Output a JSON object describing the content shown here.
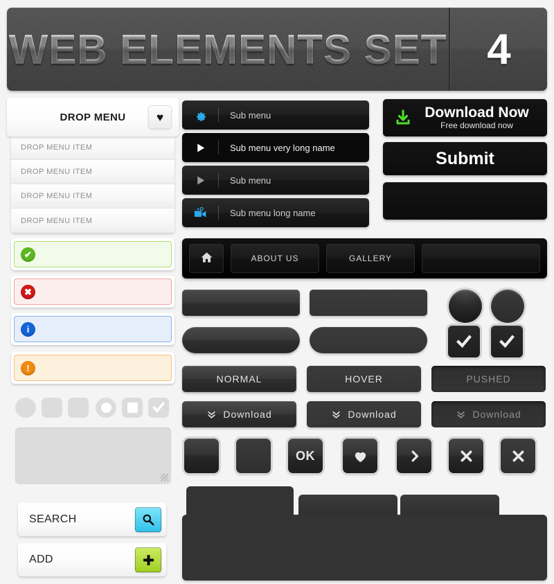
{
  "banner": {
    "title": "WEB ELEMENTS SET",
    "number": "4"
  },
  "drop_menu": {
    "label": "DROP MENU",
    "toggle_icon": "heart-icon",
    "toggle_glyph": "♥",
    "items": [
      {
        "label": "DROP MENU ITEM"
      },
      {
        "label": "DROP MENU ITEM"
      },
      {
        "label": "DROP MENU ITEM"
      },
      {
        "label": "DROP MENU ITEM"
      }
    ]
  },
  "sub_menus": [
    {
      "label": "Sub menu",
      "icon": "gear-icon",
      "glyph": "⚙",
      "icon_color": "#2aa8e8",
      "style": "dark-grey"
    },
    {
      "label": "Sub menu very long name",
      "icon": "play-icon",
      "glyph": "▶",
      "icon_color": "#ffffff",
      "style": "black"
    },
    {
      "label": "Sub menu",
      "icon": "play-icon",
      "glyph": "▶",
      "icon_color": "#9a9a9a",
      "style": "dark-grey"
    },
    {
      "label": "Sub menu long name",
      "icon": "video-camera-icon",
      "glyph": "🎥",
      "icon_color": "#2aa8e8",
      "style": "dark-grey"
    }
  ],
  "download_button": {
    "title": "Download Now",
    "subtitle": "Free download now",
    "icon": "download-arrow-icon",
    "icon_color": "#4ade2a"
  },
  "submit_button": {
    "label": "Submit"
  },
  "empty_black_button": {
    "label": ""
  },
  "alerts": [
    {
      "type": "success",
      "icon": "check-circle-icon",
      "glyph": "✔",
      "dot_color": "#5cb820",
      "border_color": "#a8dd6e",
      "bg_color": "#f2fbe9"
    },
    {
      "type": "error",
      "icon": "x-circle-icon",
      "glyph": "✖",
      "dot_color": "#d01818",
      "border_color": "#f0a0a0",
      "bg_color": "#fdeeee"
    },
    {
      "type": "info",
      "icon": "info-circle-icon",
      "glyph": "i",
      "dot_color": "#1565d8",
      "border_color": "#86b4ec",
      "bg_color": "#e7eefb"
    },
    {
      "type": "warning",
      "icon": "warning-circle-icon",
      "glyph": "!",
      "dot_color": "#f08a10",
      "border_color": "#f5c179",
      "bg_color": "#fdf0dc"
    }
  ],
  "navbar": {
    "home_icon": "home-icon",
    "home_glyph": "⌂",
    "tabs": [
      {
        "label": "ABOUT US"
      },
      {
        "label": "GALLERY"
      },
      {
        "label": ""
      }
    ]
  },
  "button_states": [
    {
      "label": "NORMAL",
      "state": "normal"
    },
    {
      "label": "HOVER",
      "state": "hover"
    },
    {
      "label": "PUSHED",
      "state": "pushed"
    }
  ],
  "download_row": [
    {
      "label": "Download",
      "state": "normal",
      "icon": "double-chevron-down-icon",
      "glyph": "⌄"
    },
    {
      "label": "Download",
      "state": "hover",
      "icon": "double-chevron-down-icon",
      "glyph": "⌄"
    },
    {
      "label": "Download",
      "state": "pushed",
      "icon": "double-chevron-down-icon",
      "glyph": "⌄"
    }
  ],
  "icon_buttons": [
    {
      "label": "",
      "icon": "blank-icon",
      "glyph": "",
      "variant": "g1"
    },
    {
      "label": "",
      "icon": "blank-icon",
      "glyph": "",
      "variant": "g2"
    },
    {
      "label": "OK",
      "icon": "ok-text-icon",
      "glyph": "OK",
      "variant": "g1"
    },
    {
      "label": "",
      "icon": "heart-icon",
      "glyph": "♥",
      "variant": "g1"
    },
    {
      "label": "",
      "icon": "chevron-right-icon",
      "glyph": "❯",
      "variant": "g1"
    },
    {
      "label": "",
      "icon": "close-x-icon",
      "glyph": "✖",
      "variant": "g1"
    },
    {
      "label": "",
      "icon": "close-x-icon",
      "glyph": "✖",
      "variant": "g2"
    }
  ],
  "round_buttons": [
    {
      "style": "glossy"
    },
    {
      "style": "matte"
    }
  ],
  "check_buttons": [
    {
      "icon": "checkmark-icon",
      "glyph": "✔",
      "checked": true
    },
    {
      "icon": "checkmark-icon",
      "glyph": "✔",
      "checked": true
    }
  ],
  "form_controls": [
    {
      "name": "radio-circle",
      "shape": "circle",
      "inner": "none"
    },
    {
      "name": "rounded-square-1",
      "shape": "rsq",
      "inner": "none"
    },
    {
      "name": "rounded-square-2",
      "shape": "rsq",
      "inner": "none"
    },
    {
      "name": "radio-unchecked",
      "shape": "circle",
      "inner": "circle"
    },
    {
      "name": "checkbox-unchecked",
      "shape": "rsq",
      "inner": "square"
    },
    {
      "name": "checkbox-checked",
      "shape": "rsq",
      "inner": "check",
      "glyph": "✔"
    }
  ],
  "textarea": {
    "value": "",
    "placeholder": ""
  },
  "fields": [
    {
      "label": "SEARCH",
      "button_icon": "search-icon",
      "glyph": "🔍",
      "button_color_top": "#7fe6fb",
      "button_color_bottom": "#2ec2ec"
    },
    {
      "label": "ADD",
      "button_icon": "plus-icon",
      "glyph": "✚",
      "button_color_top": "#cdeb62",
      "button_color_bottom": "#9fcf22"
    }
  ],
  "tab_panel": {
    "tabs": [
      {
        "label": "",
        "active": true
      },
      {
        "label": "",
        "active": false
      },
      {
        "label": "",
        "active": false
      }
    ],
    "content": ""
  },
  "colors": {
    "page_background": "#f4f4f4",
    "banner_dark": "#4a4a4a",
    "accent_blue": "#2aa8e8",
    "accent_green": "#4ade2a",
    "accent_cyan": "#2ec2ec",
    "accent_lime": "#9fcf22"
  }
}
